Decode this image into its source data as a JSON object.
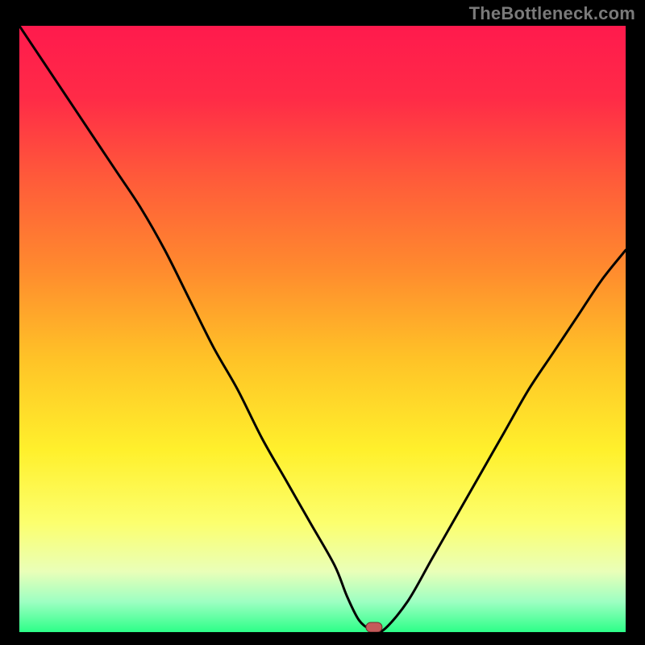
{
  "watermark": "TheBottleneck.com",
  "colors": {
    "frame": "#000000",
    "watermark_text": "#7a7a7a",
    "gradient_stops": [
      {
        "offset": 0.0,
        "color": "#ff1a4d"
      },
      {
        "offset": 0.12,
        "color": "#ff2b47"
      },
      {
        "offset": 0.25,
        "color": "#ff5a3a"
      },
      {
        "offset": 0.4,
        "color": "#ff8a2e"
      },
      {
        "offset": 0.55,
        "color": "#ffc327"
      },
      {
        "offset": 0.7,
        "color": "#fff02c"
      },
      {
        "offset": 0.82,
        "color": "#fcff6e"
      },
      {
        "offset": 0.9,
        "color": "#e9ffb8"
      },
      {
        "offset": 0.95,
        "color": "#9dffc2"
      },
      {
        "offset": 1.0,
        "color": "#2cff88"
      }
    ],
    "curve": "#000000",
    "marker_fill": "#c45a5a",
    "marker_stroke": "#6b2e2e"
  },
  "chart_data": {
    "type": "line",
    "title": "",
    "xlabel": "",
    "ylabel": "",
    "xlim": [
      0,
      100
    ],
    "ylim": [
      0,
      100
    ],
    "grid": false,
    "legend": false,
    "x": [
      0,
      4,
      8,
      12,
      16,
      20,
      24,
      28,
      32,
      36,
      40,
      44,
      48,
      52,
      54,
      56,
      58,
      60,
      64,
      68,
      72,
      76,
      80,
      84,
      88,
      92,
      96,
      100
    ],
    "values": [
      100,
      94,
      88,
      82,
      76,
      70,
      63,
      55,
      47,
      40,
      32,
      25,
      18,
      11,
      6,
      2,
      0.4,
      0.3,
      5,
      12,
      19,
      26,
      33,
      40,
      46,
      52,
      58,
      63
    ],
    "notch_min": {
      "x": 58,
      "y": 0.3
    },
    "marker": {
      "x": 58.5,
      "y": 0.8
    }
  }
}
